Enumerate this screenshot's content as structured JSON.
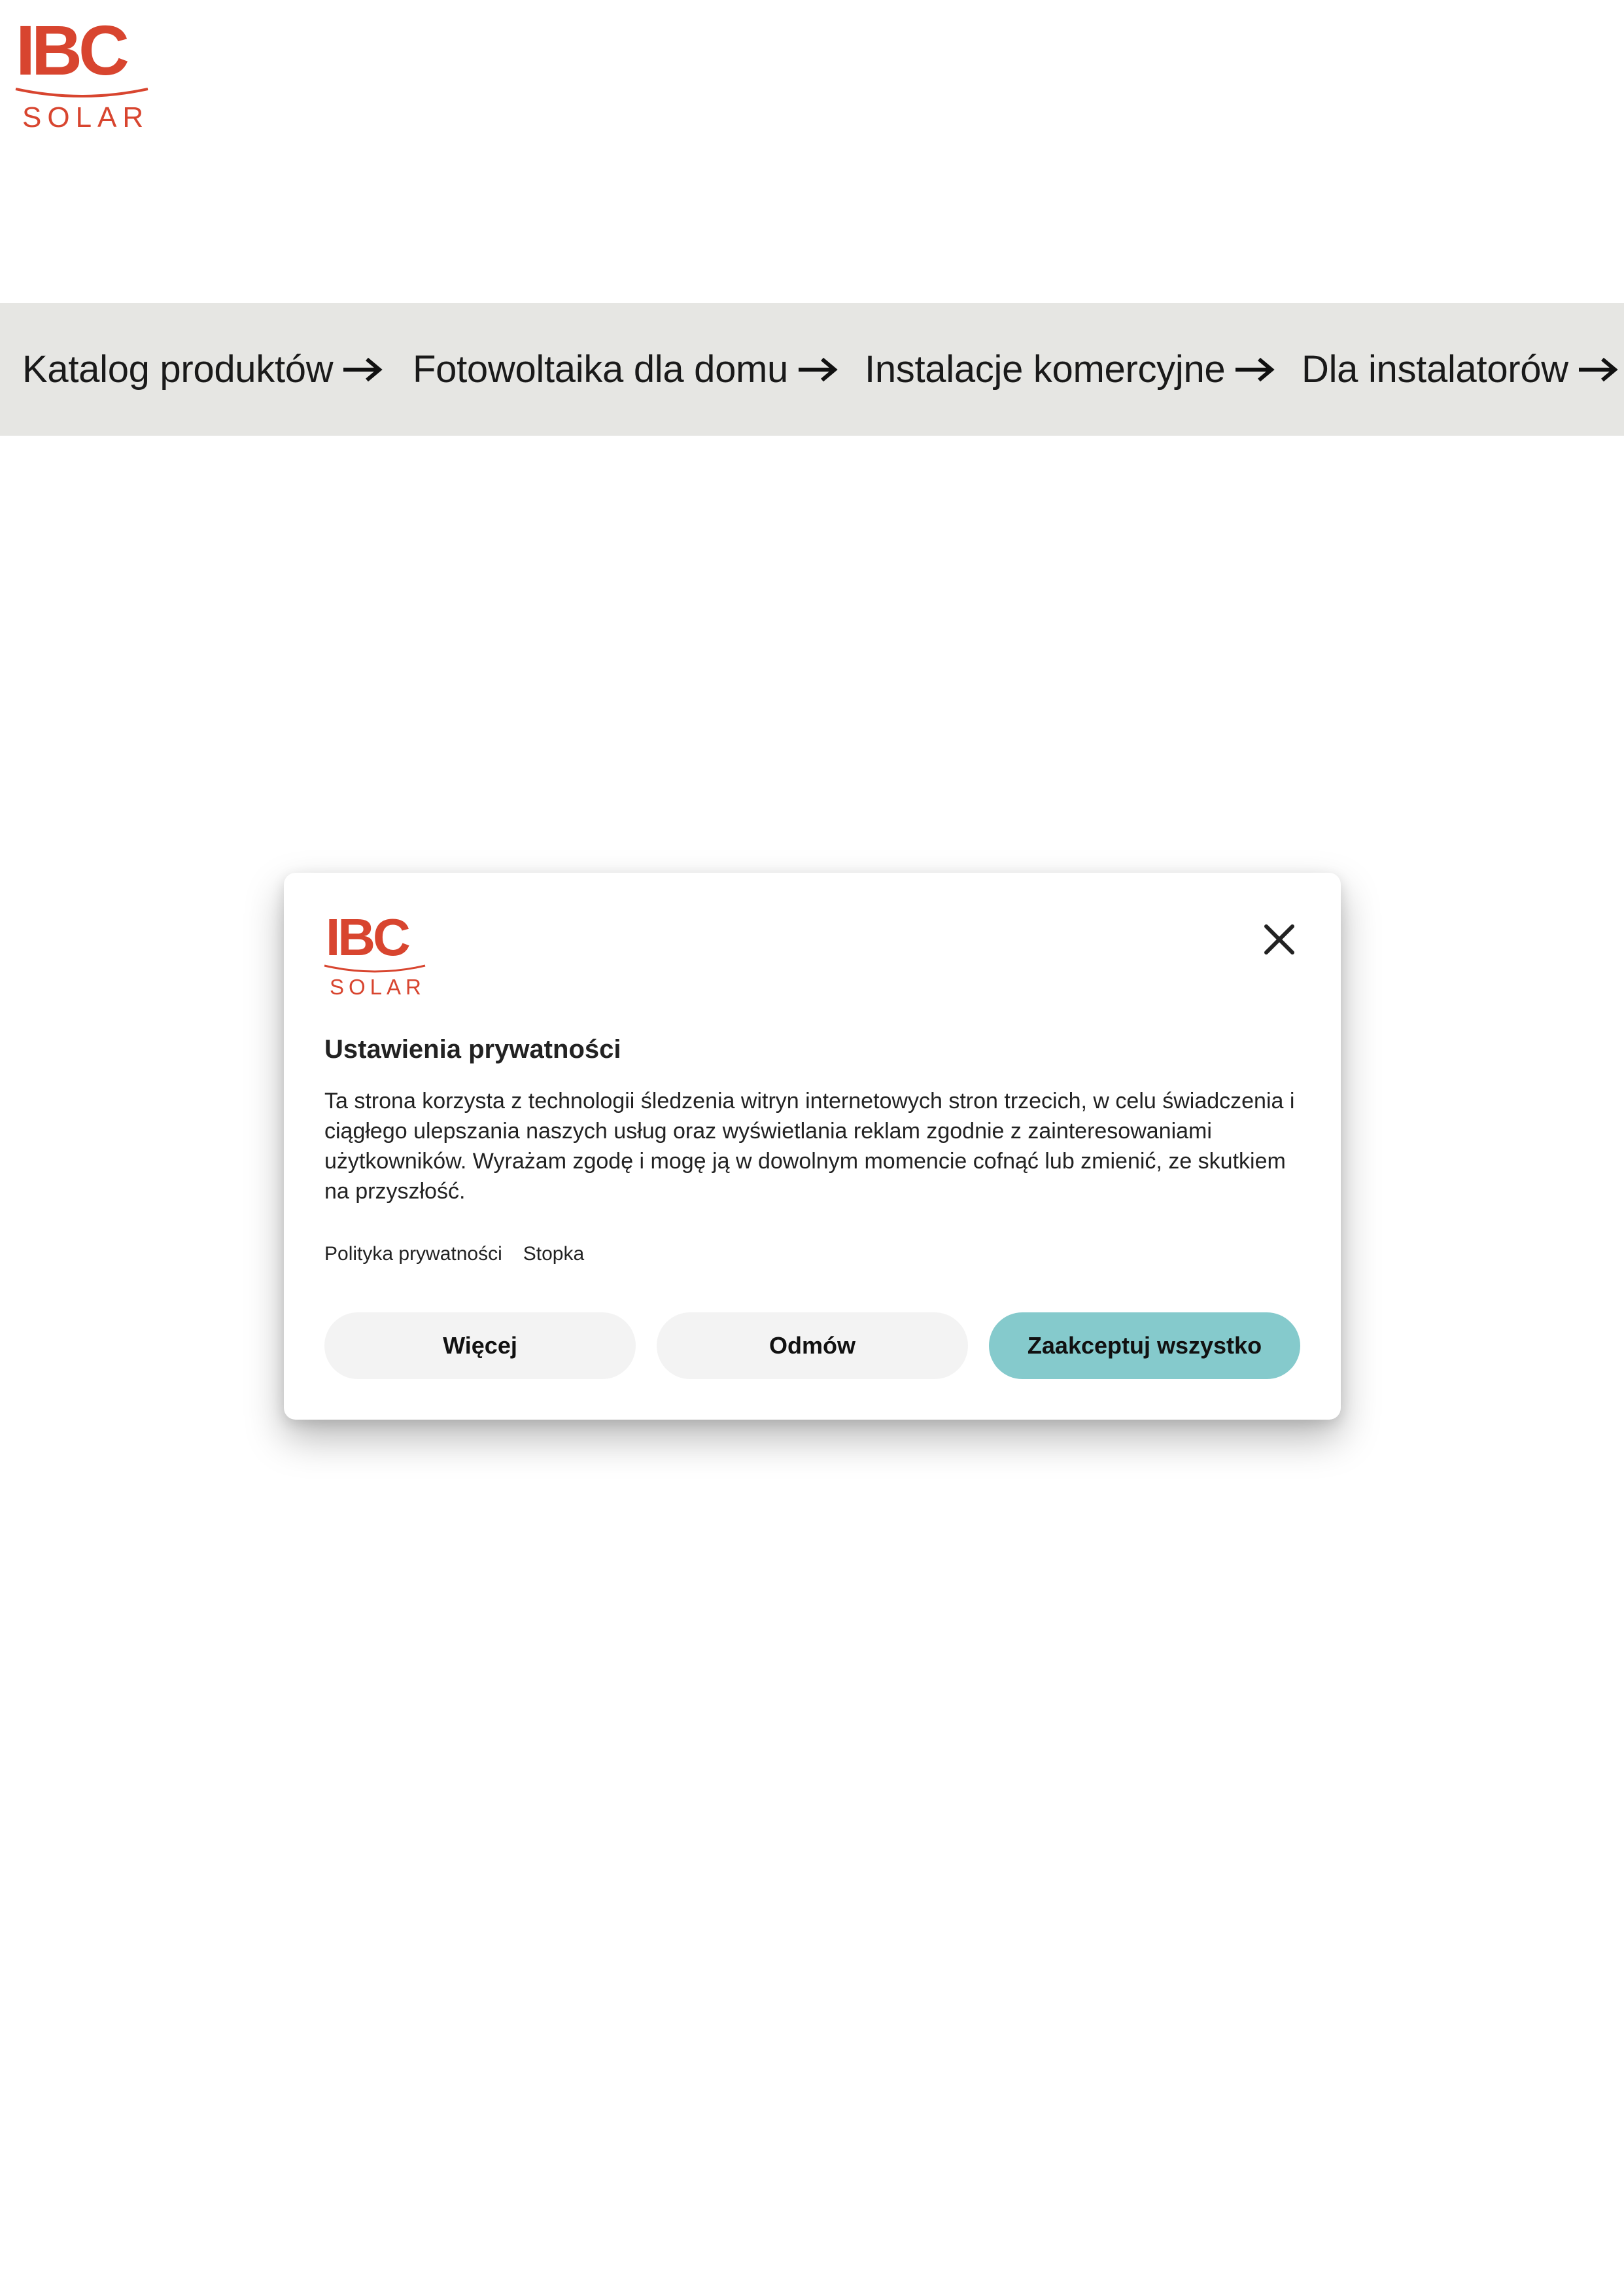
{
  "brand": {
    "logo_text_top": "IBC",
    "logo_text_bottom": "SOLAR",
    "color": "#d8452f"
  },
  "nav": {
    "items": [
      {
        "label": "Katalog produktów",
        "icon": "arrow-right-icon"
      },
      {
        "label": "Fotowoltaika dla domu",
        "icon": "arrow-right-icon"
      },
      {
        "label": "Instalacje komercyjne",
        "icon": "arrow-right-icon"
      },
      {
        "label": "Dla instalatorów",
        "icon": "arrow-right-icon"
      }
    ],
    "background": "#e6e6e3"
  },
  "consent": {
    "logo_text_top": "IBC",
    "logo_text_bottom": "SOLAR",
    "close_icon": "close-icon",
    "title": "Ustawienia prywatności",
    "body": "Ta strona korzysta z technologii śledzenia witryn internetowych stron trzecich, w celu świadczenia i ciągłego ulepszania naszych usług oraz wyświetlania reklam zgodnie z zainteresowaniami użytkowników. Wyrażam zgodę i mogę ją w dowolnym momencie cofnąć lub zmienić, ze skutkiem na przyszłość.",
    "links": {
      "privacy_policy": "Polityka prywatności",
      "footer": "Stopka"
    },
    "buttons": {
      "more": "Więcej",
      "decline": "Odmów",
      "accept_all": "Zaakceptuj wszystko"
    },
    "accent_color": "#85cacc"
  }
}
